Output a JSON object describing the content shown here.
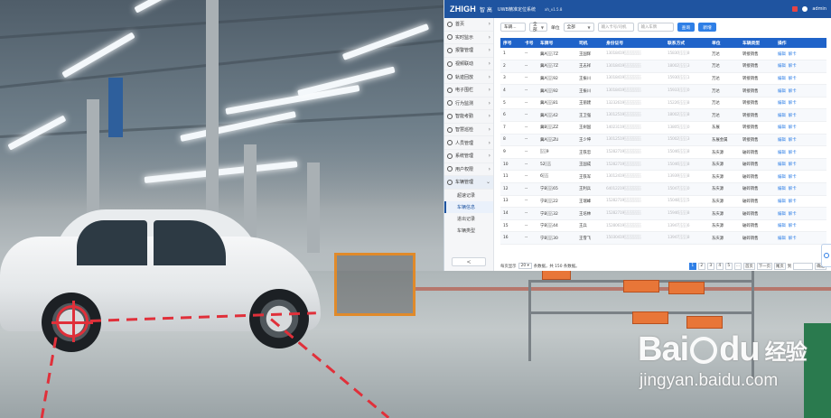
{
  "window": {
    "logo": "ZHIGH",
    "logo_cn": "智 高",
    "system_title": "UWB精准定位系统",
    "version": "xh_v1.5.8",
    "username": "admin"
  },
  "sidebar": {
    "items": [
      {
        "label": "首页",
        "icon": "home-icon"
      },
      {
        "label": "实时监示",
        "icon": "eye-icon"
      },
      {
        "label": "报警管理",
        "icon": "alarm-icon"
      },
      {
        "label": "视频联动",
        "icon": "video-icon"
      },
      {
        "label": "轨迹回放",
        "icon": "track-icon"
      },
      {
        "label": "电子围栏",
        "icon": "fence-icon"
      },
      {
        "label": "行为监测",
        "icon": "behavior-icon"
      },
      {
        "label": "智能考勤",
        "icon": "attendance-icon"
      },
      {
        "label": "智慧巡检",
        "icon": "patrol-icon"
      },
      {
        "label": "人员管理",
        "icon": "people-icon"
      },
      {
        "label": "系统管理",
        "icon": "gear-icon"
      },
      {
        "label": "用户权限",
        "icon": "user-icon"
      },
      {
        "label": "车辆管理",
        "icon": "car-icon"
      }
    ],
    "sub_items": [
      "超速记录",
      "车辆信息",
      "进出记录",
      "车辆类型"
    ],
    "active_sub": "车辆信息",
    "collapse_glyph": "<"
  },
  "toolbar": {
    "filter1": "车辆...",
    "filter2": "全部",
    "unit_label": "单位",
    "unit_value": "全部",
    "input1_placeholder": "输入卡号/司机",
    "input2_placeholder": "输入车牌",
    "query_label": "查询",
    "add_label": "新增"
  },
  "table": {
    "columns": [
      "序号",
      "卡号",
      "车牌号",
      "司机",
      "身份证号",
      "联系方式",
      "单位",
      "车辆类型",
      "操作"
    ],
    "rows": [
      [
        "1",
        "--",
        "冀A░░7Z",
        "王国辉",
        "13018419░░░░░░",
        "15830░░░8",
        "万达",
        "转接销售"
      ],
      [
        "2",
        "--",
        "冀A░░7Z",
        "王志祥",
        "13018419░░░░░░",
        "18002░░░3",
        "万达",
        "转接销售"
      ],
      [
        "3",
        "--",
        "冀A░░92",
        "王振川",
        "13018419░░░░░░",
        "15930░░░1",
        "万达",
        "转接销售"
      ],
      [
        "4",
        "--",
        "冀A░░92",
        "王振川",
        "13018419░░░░░░",
        "15933░░░0",
        "万达",
        "转接销售"
      ],
      [
        "5",
        "--",
        "冀A░░81",
        "王丽建",
        "13232619░░░░░░",
        "15226░░░8",
        "万达",
        "转接销售"
      ],
      [
        "6",
        "--",
        "冀A░░42",
        "王卫强",
        "13012519░░░░░░",
        "18002░░░8",
        "万达",
        "转接销售"
      ],
      [
        "7",
        "--",
        "冀B░░ZZ",
        "王树国",
        "14023119░░░░░░",
        "13805░░░0",
        "东展",
        "转接销售"
      ],
      [
        "8",
        "--",
        "冀A░░ZU",
        "王少坤",
        "13012519░░░░░░",
        "15002░░░3",
        "东展金属",
        "转接销售"
      ],
      [
        "9",
        "--",
        "░░9",
        "王铁忠",
        "15282719░░░░░░",
        "15046░░░8",
        "东庆源",
        "破碎销售"
      ],
      [
        "10",
        "--",
        "52░░",
        "王国成",
        "15282719░░░░░░",
        "15046░░░8",
        "东庆源",
        "破碎销售"
      ],
      [
        "11",
        "--",
        "6░░",
        "王铁军",
        "13012419░░░░░░",
        "13939░░░8",
        "东庆源",
        "破碎销售"
      ],
      [
        "12",
        "--",
        "宁B░░65",
        "王利兵",
        "64012219░░░░░░",
        "15047░░░0",
        "东庆源",
        "破碎销售"
      ],
      [
        "13",
        "--",
        "宁B░░22",
        "王瑞峰",
        "15282719░░░░░░",
        "15048░░░5",
        "东庆源",
        "破碎销售"
      ],
      [
        "14",
        "--",
        "宁B░░32",
        "王培林",
        "15282719░░░░░░",
        "15946░░░8",
        "东庆源",
        "破碎销售"
      ],
      [
        "15",
        "--",
        "宁B░░44",
        "王兵",
        "15280619░░░░░░",
        "13947░░░6",
        "东庆源",
        "破碎销售"
      ],
      [
        "16",
        "--",
        "宁B░░30",
        "王雪飞",
        "15030419░░░░░░",
        "13947░░░8",
        "东庆源",
        "破碎销售"
      ]
    ],
    "op_edit": "编辑",
    "op_unbind": "解卡"
  },
  "pager": {
    "prefix": "每页显示",
    "page_size": "20",
    "suffix": "条数据，共 150 条数据。",
    "pages": [
      "1",
      "2",
      "3",
      "4",
      "5",
      "..."
    ],
    "current_page": "1",
    "first": "首页",
    "next": "下一页",
    "last": "尾页",
    "goto_label": "到",
    "confirm": "确定"
  },
  "watermark": {
    "logo": "Bai",
    "logo_tail": "du",
    "cn": "经验",
    "url": "jingyan.baidu.com"
  },
  "colors": {
    "header_blue": "#1f54a0",
    "table_head": "#1f63c9",
    "link_blue": "#2f7fe6",
    "target_red": "#e0303a"
  }
}
